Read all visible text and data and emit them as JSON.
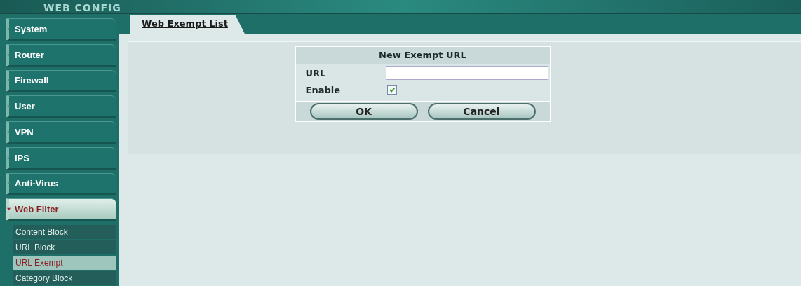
{
  "header": {
    "title": "WEB CONFIG"
  },
  "sidebar": {
    "items": [
      {
        "label": "System",
        "expanded": false
      },
      {
        "label": "Router",
        "expanded": false
      },
      {
        "label": "Firewall",
        "expanded": false
      },
      {
        "label": "User",
        "expanded": false
      },
      {
        "label": "VPN",
        "expanded": false
      },
      {
        "label": "IPS",
        "expanded": false
      },
      {
        "label": "Anti-Virus",
        "expanded": false
      },
      {
        "label": "Web Filter",
        "expanded": true,
        "children": [
          {
            "label": "Content Block",
            "selected": false
          },
          {
            "label": "URL Block",
            "selected": false
          },
          {
            "label": "URL Exempt",
            "selected": true
          },
          {
            "label": "Category Block",
            "selected": false
          }
        ]
      }
    ]
  },
  "tabs": [
    {
      "label": "Web Exempt List",
      "selected": true
    }
  ],
  "form": {
    "title": "New Exempt URL",
    "url_label": "URL",
    "enable_label": "Enable",
    "enable_checked": true,
    "buttons": [
      "OK",
      "Cancel"
    ]
  }
}
